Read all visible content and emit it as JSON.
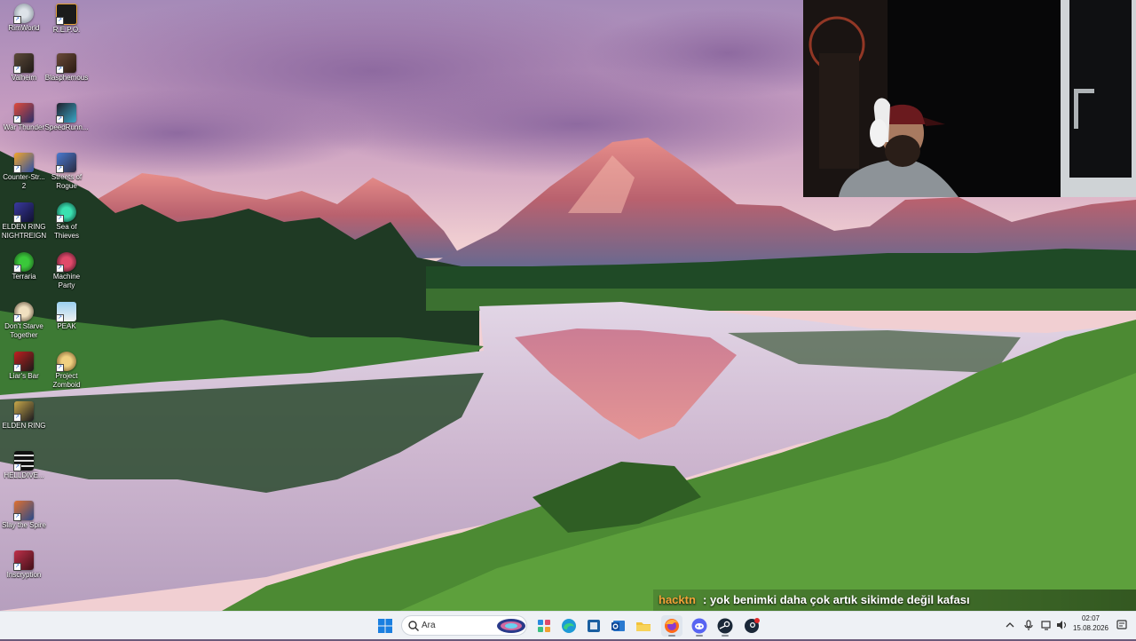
{
  "desktop_icons": [
    {
      "label": "RimWorld"
    },
    {
      "label": "R.E.P.O."
    },
    {
      "label": "Valheim"
    },
    {
      "label": "Blasphemous"
    },
    {
      "label": "War Thunder"
    },
    {
      "label": "SpeedRunn..."
    },
    {
      "label": "Counter-Str...\n2"
    },
    {
      "label": "Streets of\nRogue"
    },
    {
      "label": "ELDEN RING\nNIGHTREIGN"
    },
    {
      "label": "Sea of\nThieves"
    },
    {
      "label": "Terraria"
    },
    {
      "label": "Machine\nParty"
    },
    {
      "label": "Don't Starve\nTogether"
    },
    {
      "label": "PEAK"
    },
    {
      "label": "Liar's Bar"
    },
    {
      "label": "Project\nZomboid"
    },
    {
      "label": "ELDEN RING"
    },
    {
      "label": "HELLDIVE..."
    },
    {
      "label": "Slay the Spire"
    },
    {
      "label": "Inscryption"
    }
  ],
  "chat": {
    "username": "hacktn",
    "message": ": yok benimki daha çok artık sikimde değil kafası"
  },
  "taskbar": {
    "search_placeholder": "Ara",
    "apps": [
      "start",
      "search",
      "widgets",
      "store",
      "edge",
      "powertoys",
      "outlook",
      "file-explorer",
      "firefox",
      "discord",
      "steam",
      "steam-client"
    ],
    "clock_time": "02:07",
    "clock_date": "15.08.2026"
  },
  "colors": {
    "taskbar_bg": "#eef1f5",
    "chat_username": "#f3a338",
    "windows_blue": "#1a7fe0"
  }
}
